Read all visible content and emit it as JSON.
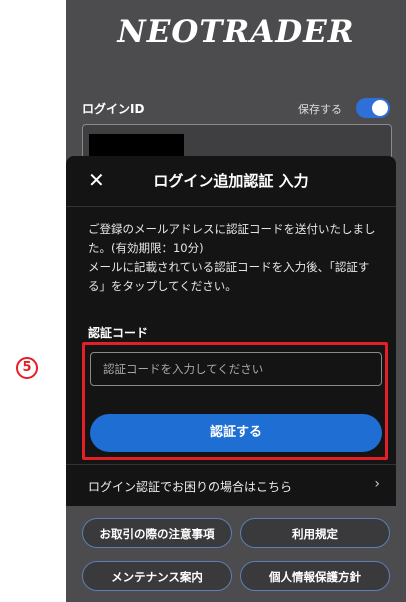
{
  "app": {
    "logo_text": "NEOTRADER",
    "login_id_label": "ログインID",
    "save_label": "保存する",
    "save_toggle": "on"
  },
  "modal": {
    "close_glyph": "✕",
    "title": "ログイン追加認証 入力",
    "description_lines": [
      "ご登録のメールアドレスに認証コードを送付いたしました。(有効期限：10分)",
      "メールに記載されている認証コードを入力後、「認証する」をタップしてください。"
    ],
    "code_label": "認証コード",
    "code_placeholder": "認証コードを入力してください",
    "code_value": "",
    "submit_label": "認証する",
    "help_text": "ログイン認証でお困りの場合はこちら",
    "help_chevron": "›"
  },
  "annotation": {
    "step_marker": "5",
    "highlight_color": "#e41f26"
  },
  "footer_buttons": [
    "お取引の際の注意事項",
    "利用規定",
    "メンテナンス案内",
    "個人情報保護方針"
  ],
  "colors": {
    "accent": "#1f6ed4",
    "background": "#4c4c4e",
    "modal_bg": "#141414"
  }
}
